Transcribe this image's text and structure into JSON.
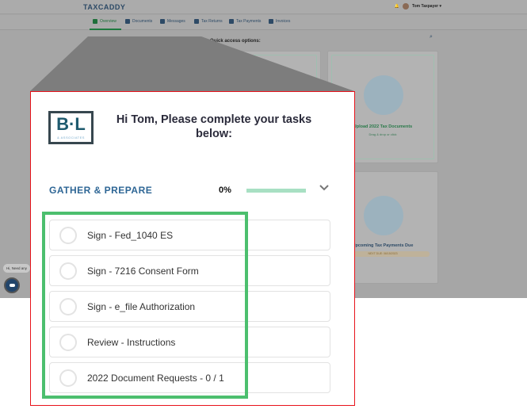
{
  "header": {
    "logo": "TAXCADDY",
    "user_name": "Tom Taxpayer ▾"
  },
  "nav": {
    "items": [
      {
        "label": "Overview",
        "active": true
      },
      {
        "label": "Documents"
      },
      {
        "label": "Messages"
      },
      {
        "label": "Tax Returns"
      },
      {
        "label": "Tax Payments"
      },
      {
        "label": "Invoices"
      }
    ],
    "search_icon": "⌕"
  },
  "quick_access": {
    "title": "Quick access options:",
    "upload_card": {
      "title": "Upload 2022 Tax Documents",
      "subtitle": "Drag & drop or click"
    },
    "payments_card": {
      "title": "Upcoming Tax Payments Due",
      "due": "NEXT DUE: 06/15/2023"
    }
  },
  "chat": {
    "bubble": "Hi, Need any"
  },
  "panel": {
    "logo_text": "B·L",
    "logo_sub": "& ASSOCIATES",
    "greeting": "Hi Tom, Please complete your tasks below:",
    "section": "GATHER & PREPARE",
    "percent": "0%",
    "progress": 0,
    "tasks": [
      "Sign - Fed_1040 ES",
      "Sign - 7216 Consent Form",
      "Sign - e_file Authorization",
      "Review - Instructions",
      "2022 Document Requests - 0 / 1"
    ]
  },
  "colors": {
    "highlight": "#4cbf6e",
    "zoom_border": "#e8131b",
    "section": "#2e6695",
    "progress": "#a8e0c3"
  }
}
